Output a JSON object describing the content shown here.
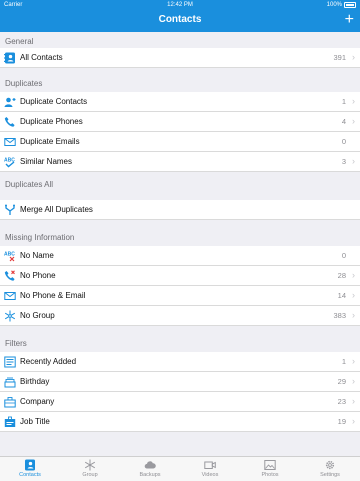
{
  "status": {
    "carrier": "Carrier",
    "time": "12:42 PM",
    "battery": "100%"
  },
  "nav": {
    "title": "Contacts",
    "add_label": "+"
  },
  "sections": [
    {
      "header": "General",
      "rows": [
        {
          "label": "All Contacts",
          "count": "391",
          "icon": "contacts-book-icon"
        }
      ]
    },
    {
      "header": "Duplicates",
      "rows": [
        {
          "label": "Duplicate Contacts",
          "count": "1",
          "icon": "duplicate-person-icon"
        },
        {
          "label": "Duplicate Phones",
          "count": "4",
          "icon": "phone-icon"
        },
        {
          "label": "Duplicate Emails",
          "count": "0",
          "icon": "envelope-icon"
        },
        {
          "label": "Similar Names",
          "count": "3",
          "icon": "abc-check-icon"
        }
      ]
    },
    {
      "header": "Duplicates All",
      "rows": [
        {
          "label": "Merge All Duplicates",
          "count": "",
          "icon": "merge-icon"
        }
      ]
    },
    {
      "header": "Missing Information",
      "rows": [
        {
          "label": "No Name",
          "count": "0",
          "icon": "abc-cross-icon"
        },
        {
          "label": "No Phone",
          "count": "28",
          "icon": "phone-cross-icon"
        },
        {
          "label": "No Phone & Email",
          "count": "14",
          "icon": "envelope-cross-icon"
        },
        {
          "label": "No Group",
          "count": "383",
          "icon": "snowflake-icon"
        }
      ]
    },
    {
      "header": "Filters",
      "rows": [
        {
          "label": "Recently Added",
          "count": "1",
          "icon": "clock-list-icon"
        },
        {
          "label": "Birthday",
          "count": "29",
          "icon": "cake-icon"
        },
        {
          "label": "Company",
          "count": "23",
          "icon": "building-icon"
        },
        {
          "label": "Job Title",
          "count": "19",
          "icon": "badge-icon"
        }
      ]
    }
  ],
  "tabs": [
    {
      "label": "Contacts",
      "icon": "contacts-tab-icon",
      "active": true
    },
    {
      "label": "Group",
      "icon": "snowflake-tab-icon",
      "active": false
    },
    {
      "label": "Backups",
      "icon": "cloud-tab-icon",
      "active": false
    },
    {
      "label": "Videos",
      "icon": "video-tab-icon",
      "active": false
    },
    {
      "label": "Photos",
      "icon": "photo-tab-icon",
      "active": false
    },
    {
      "label": "Settings",
      "icon": "gear-tab-icon",
      "active": false
    }
  ],
  "colors": {
    "accent": "#1a8fdd",
    "background": "#efeff4"
  }
}
